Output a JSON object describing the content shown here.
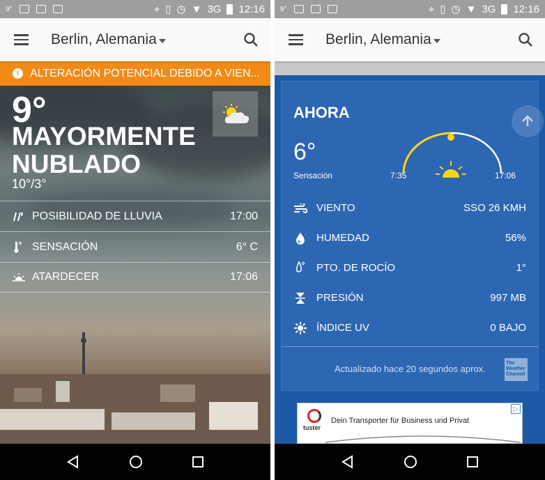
{
  "status_bar": {
    "temp": "9°",
    "network": "3G",
    "time": "12:16"
  },
  "app_bar": {
    "location": "Berlin, Alemania"
  },
  "left": {
    "alert_text": "ALTERACIÓN POTENCIAL DEBIDO A VIEN...",
    "temperature": "9°",
    "condition": "MAYORMENTE NUBLADO",
    "hi_lo": "10°/3°",
    "rows": [
      {
        "icon": "rain-icon",
        "label": "POSIBILIDAD DE LLUVIA",
        "value": "17:00"
      },
      {
        "icon": "thermometer-icon",
        "label": "SENSACIÓN",
        "value": "6° C"
      },
      {
        "icon": "sunset-icon",
        "label": "ATARDECER",
        "value": "17:06"
      }
    ]
  },
  "right": {
    "heading": "AHORA",
    "temperature": "6°",
    "feels_label": "Sensación",
    "sunrise": "7:35",
    "sunset": "17:06",
    "rows": [
      {
        "icon": "wind-icon",
        "label": "VIENTO",
        "value": "SSO 26 KMH"
      },
      {
        "icon": "humidity-icon",
        "label": "HUMEDAD",
        "value": "56%"
      },
      {
        "icon": "dewpoint-icon",
        "label": "PTO. DE ROCÍO",
        "value": "1°"
      },
      {
        "icon": "pressure-icon",
        "label": "PRESIÓN",
        "value": "997 MB"
      },
      {
        "icon": "uv-icon",
        "label": "ÍNDICE UV",
        "value": "0 BAJO"
      }
    ],
    "updated": "Actualizado hace 20 segundos aprox.",
    "logo_text": "The Weather Channel",
    "ad": {
      "brand": "tuster",
      "text": "Dein Transporter für Business und Privat"
    }
  },
  "colors": {
    "alert": "#f28a17",
    "card": "#2d66b3",
    "sun": "#f7d416"
  }
}
